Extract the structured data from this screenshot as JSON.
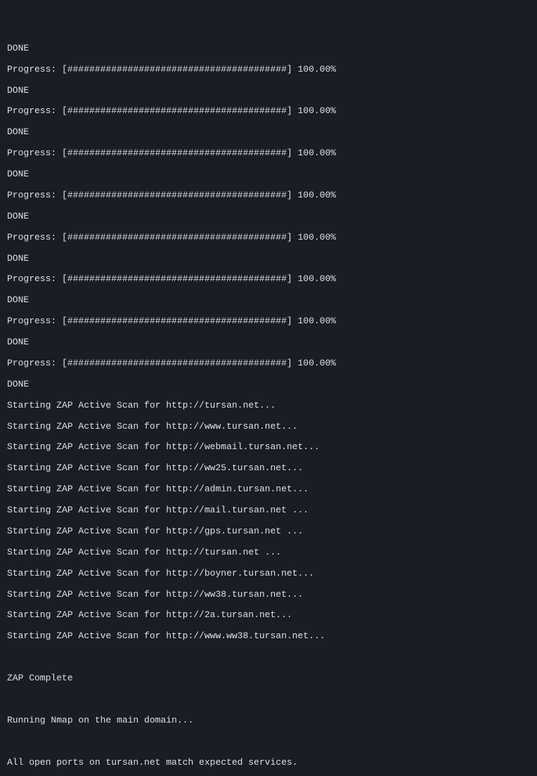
{
  "initial_done": "DONE",
  "progress": {
    "label": "Progress: ",
    "bar": "[########################################]",
    "pct": " 100.00%",
    "done": "DONE"
  },
  "scans": {
    "prefix": "Starting ZAP Active Scan for ",
    "suffix": "...",
    "targets": [
      "http://tursan.net",
      "http://www.tursan.net",
      "http://webmail.tursan.net",
      "http://ww25.tursan.net",
      "http://admin.tursan.net",
      "http://mail.tursan.net ",
      "http://gps.tursan.net ",
      "http://tursan.net ",
      "http://boyner.tursan.net",
      "http://ww38.tursan.net",
      "http://2a.tursan.net",
      "http://www.ww38.tursan.net"
    ]
  },
  "zap_complete": "ZAP Complete",
  "nmap_line": "Running Nmap on the main domain...",
  "ports_line": "All open ports on tursan.net match expected services."
}
